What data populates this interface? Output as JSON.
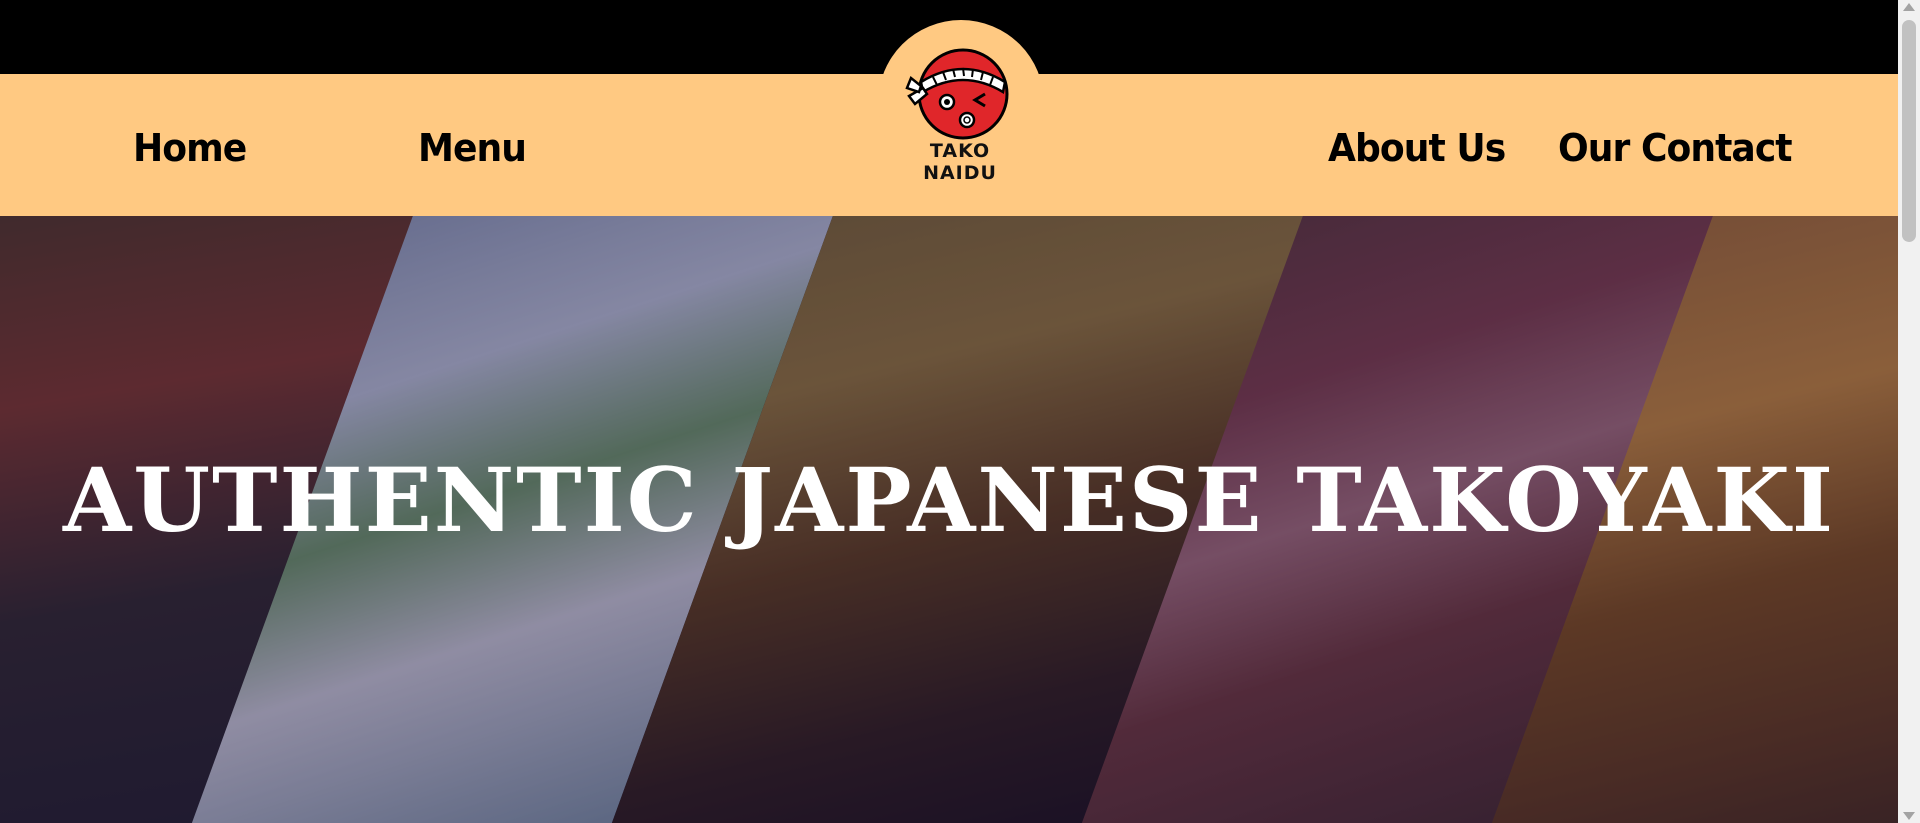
{
  "brand": {
    "name": "TAKO NAIDU",
    "logo_icon": "takoyaki-mascot-icon",
    "colors": {
      "nav_background": "#ffc982",
      "top_bar": "#000000",
      "mascot_red": "#e0262a",
      "hero_text": "#ffffff"
    }
  },
  "nav": {
    "left": [
      {
        "label": "Home"
      },
      {
        "label": "Menu"
      }
    ],
    "right": [
      {
        "label": "About Us"
      },
      {
        "label": "Our Contact"
      }
    ]
  },
  "hero": {
    "title": "AUTHENTIC JAPANESE TAKOYAKI",
    "background": "diagonal-food-photo-collage"
  }
}
